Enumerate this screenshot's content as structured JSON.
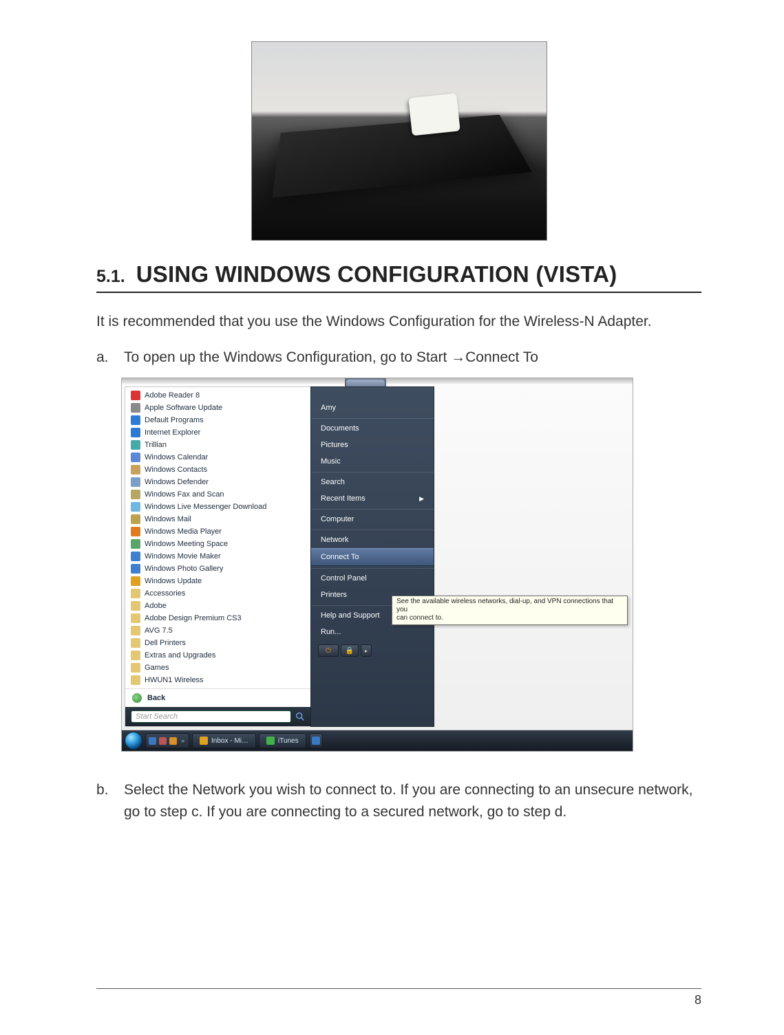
{
  "section": {
    "number": "5.1.",
    "title": "USING WINDOWS CONFIGURATION (VISTA)"
  },
  "intro": "It is recommended that you use the Windows Configuration for the Wireless-N Adapter.",
  "step_a": {
    "marker": "a.",
    "text_prefix": "To open up the Windows Configuration, go to Start ",
    "text_suffix": "Connect To"
  },
  "step_b": {
    "marker": "b.",
    "text": "Select the Network you wish to connect to. If you are connecting to an unsecure network, go to step c.  If you are connecting to a secured network, go to step d."
  },
  "start_menu": {
    "programs": [
      {
        "label": "Adobe Reader 8",
        "color": "#d33"
      },
      {
        "label": "Apple Software Update",
        "color": "#8a8a8a"
      },
      {
        "label": "Default Programs",
        "color": "#2e7bd6"
      },
      {
        "label": "Internet Explorer",
        "color": "#2e7bd6"
      },
      {
        "label": "Trillian",
        "color": "#4aa"
      },
      {
        "label": "Windows Calendar",
        "color": "#5a8ad6"
      },
      {
        "label": "Windows Contacts",
        "color": "#caa15a"
      },
      {
        "label": "Windows Defender",
        "color": "#7aa0c8"
      },
      {
        "label": "Windows Fax and Scan",
        "color": "#b7a763"
      },
      {
        "label": "Windows Live Messenger Download",
        "color": "#6fb6e0"
      },
      {
        "label": "Windows Mail",
        "color": "#bca24a"
      },
      {
        "label": "Windows Media Player",
        "color": "#e07b1e"
      },
      {
        "label": "Windows Meeting Space",
        "color": "#5aa66a"
      },
      {
        "label": "Windows Movie Maker",
        "color": "#3f7fd0"
      },
      {
        "label": "Windows Photo Gallery",
        "color": "#3f7fd0"
      },
      {
        "label": "Windows Update",
        "color": "#e0a020"
      },
      {
        "label": "Accessories",
        "color": "#e4c772"
      },
      {
        "label": "Adobe",
        "color": "#e4c772"
      },
      {
        "label": "Adobe Design Premium CS3",
        "color": "#e4c772"
      },
      {
        "label": "AVG 7.5",
        "color": "#e4c772"
      },
      {
        "label": "Dell Printers",
        "color": "#e4c772"
      },
      {
        "label": "Extras and Upgrades",
        "color": "#e4c772"
      },
      {
        "label": "Games",
        "color": "#e4c772"
      },
      {
        "label": "HWUN1 Wireless",
        "color": "#e4c772"
      }
    ],
    "back_label": "Back",
    "search_placeholder": "Start Search",
    "right_items": [
      {
        "label": "Amy",
        "sep": false
      },
      {
        "label": "Documents",
        "sep": true
      },
      {
        "label": "Pictures",
        "sep": false
      },
      {
        "label": "Music",
        "sep": false
      },
      {
        "label": "Search",
        "sep": true
      },
      {
        "label": "Recent Items",
        "sep": false,
        "arrow": true
      },
      {
        "label": "Computer",
        "sep": true
      },
      {
        "label": "Network",
        "sep": true
      },
      {
        "label": "Connect To",
        "sep": false,
        "highlight": true
      },
      {
        "label": "Control Panel",
        "sep": true
      },
      {
        "label": "Printers",
        "sep": false
      },
      {
        "label": "Help and Support",
        "sep": true
      },
      {
        "label": "Run...",
        "sep": false
      }
    ],
    "tooltip": {
      "line1": "See the available wireless networks, dial-up, and VPN connections that you",
      "line2": "can connect to."
    },
    "taskbar": {
      "task1": "Inbox - Mi…",
      "task2": "iTunes"
    }
  },
  "footer": {
    "page": "8"
  }
}
